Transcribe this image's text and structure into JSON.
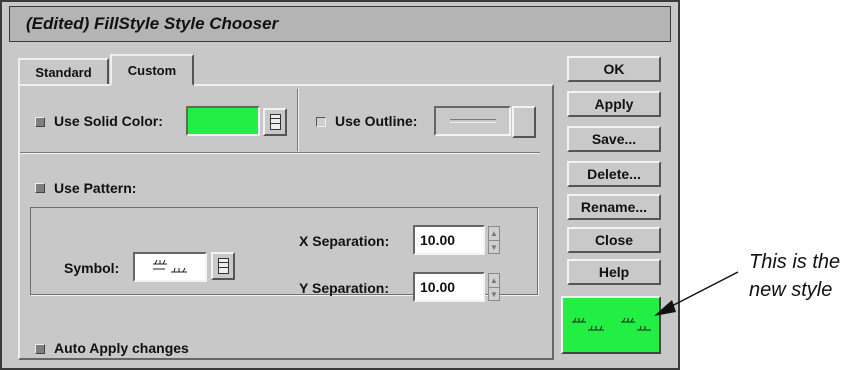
{
  "window": {
    "title": "(Edited) FillStyle Style Chooser"
  },
  "tabs": [
    {
      "label": "Standard",
      "active": false
    },
    {
      "label": "Custom",
      "active": true
    }
  ],
  "solid_color": {
    "label": "Use Solid Color:",
    "checked": true,
    "color": "#22ee44"
  },
  "outline": {
    "label": "Use Outline:",
    "checked": false
  },
  "pattern": {
    "label": "Use Pattern:",
    "checked": true
  },
  "symbol": {
    "label": "Symbol:"
  },
  "x_separation": {
    "label": "X Separation:",
    "value": "10.00"
  },
  "y_separation": {
    "label": "Y Separation:",
    "value": "10.00"
  },
  "auto_apply": {
    "label": "Auto Apply changes",
    "checked": true
  },
  "buttons": {
    "ok": "OK",
    "apply": "Apply",
    "save": "Save...",
    "delete": "Delete...",
    "rename": "Rename...",
    "close": "Close",
    "help": "Help"
  },
  "preview": {
    "fill": "#22ee44"
  },
  "annotation": {
    "line1": "This is the",
    "line2": "new style"
  },
  "colors": {
    "window_bg": "#c8c8c8",
    "title_bg": "#b4b4b4"
  }
}
